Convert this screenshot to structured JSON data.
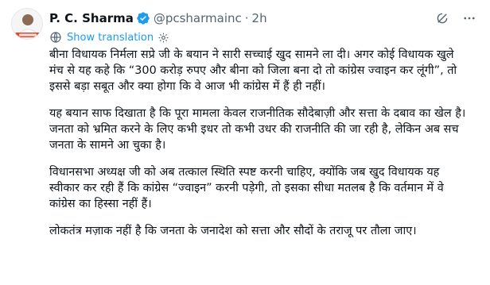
{
  "author": {
    "display_name": "P. C. Sharma",
    "handle": "@pcsharmainc",
    "separator": "·",
    "time": "2h"
  },
  "translate": {
    "label": "Show translation"
  },
  "icons": {
    "verified": "verified-badge-icon",
    "grok": "grok-icon",
    "more": "more-options-icon",
    "globe": "globe-icon",
    "settings": "settings-gear-icon"
  },
  "colors": {
    "accent": "#1d9bf0",
    "secondary_text": "#536471",
    "primary_text": "#0f1419"
  },
  "tweet": {
    "paragraphs": [
      "बीना विधायक निर्मला सप्रे जी के बयान ने सारी सच्चाई खुद सामने ला दी। अगर कोई विधायक खुले मंच से यह कहे कि “300 करोड़ रुपए और बीना को जिला बना दो तो कांग्रेस ज्वाइन कर लूंगी”, तो इससे बड़ा सबूत और क्या होगा कि वे आज भी कांग्रेस में हैं ही नहीं।",
      "यह बयान साफ दिखाता है कि पूरा मामला केवल राजनीतिक सौदेबाज़ी और सत्ता के दबाव का खेल है।\nजनता को भ्रमित करने के लिए कभी इधर तो कभी उधर की राजनीति की जा रही है, लेकिन अब सच जनता के सामने आ चुका है।",
      "विधानसभा अध्यक्ष जी को अब तत्काल स्थिति स्पष्ट करनी चाहिए, क्योंकि जब खुद विधायक यह स्वीकार कर रही हैं कि कांग्रेस “ज्वाइन” करनी पड़ेगी, तो इसका सीधा मतलब है कि वर्तमान में वे कांग्रेस का हिस्सा नहीं हैं।",
      "लोकतंत्र मज़ाक नहीं है कि जनता के जनादेश को सत्ता और सौदों के तराजू पर तौला जाए।"
    ]
  }
}
